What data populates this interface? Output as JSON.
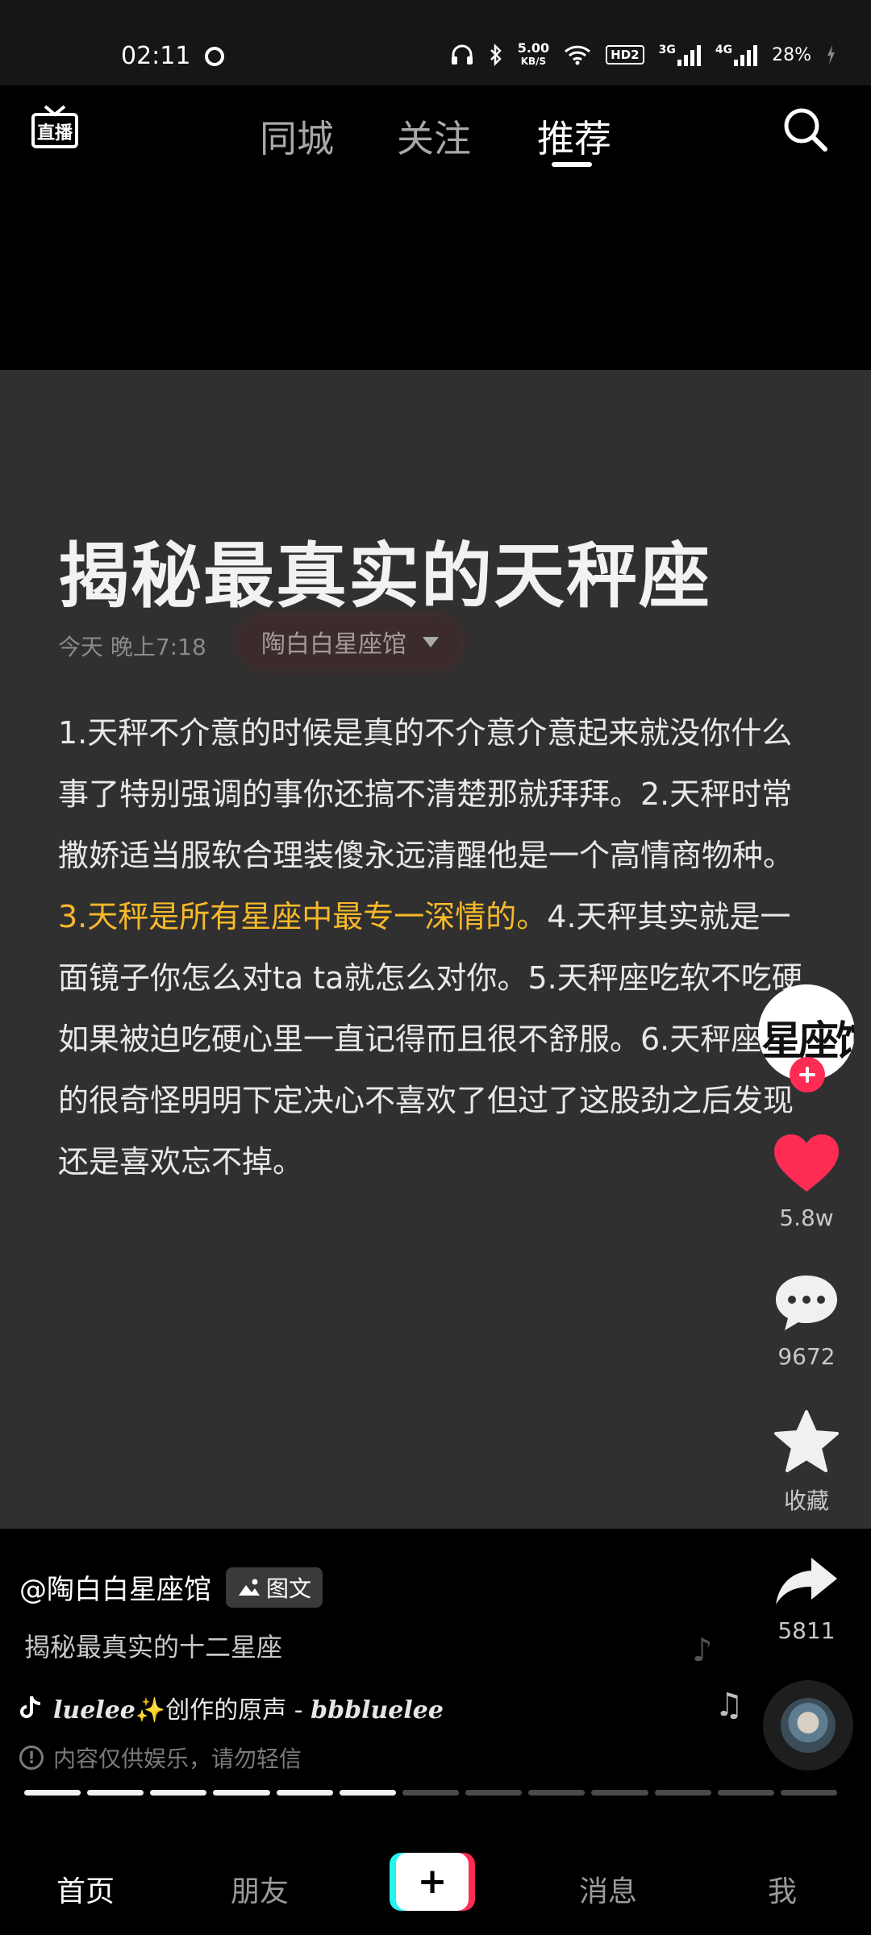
{
  "status_bar": {
    "time": "02:11",
    "net_speed_value": "5.00",
    "net_speed_unit": "KB/S",
    "hd_badge": "HD2",
    "sim1_label": "3G",
    "sim2_label": "4G",
    "battery": "28%"
  },
  "top_nav": {
    "live_label": "直播",
    "tabs": [
      "同城",
      "关注",
      "推荐"
    ],
    "active_tab": "推荐"
  },
  "post": {
    "title": "揭秘最真实的天秤座",
    "date": "今天 晚上7:18",
    "author_chip": "陶白白星座馆",
    "body_part1": "1.天秤不介意的时候是真的不介意介意起来就没你什么事了特别强调的事你还搞不清楚那就拜拜。2.天秤时常撒娇适当服软合理装傻永远清醒他是一个高情商物种。",
    "body_highlight": "3.天秤是所有星座中最专一深情的。",
    "body_part2": "4.天秤其实就是一面镜子你怎么对ta ta就怎么对你。5.天秤座吃软不吃硬如果被迫吃硬心里一直记得而且很不舒服。6.天秤座真的很奇怪明明下定决心不喜欢了但过了这股劲之后发现还是喜欢忘不掉。"
  },
  "rail": {
    "avatar_text": "星座馆",
    "likes": "5.8w",
    "comments": "9672",
    "favorite_label": "收藏",
    "shares": "5811"
  },
  "info": {
    "handle": "@陶白白星座馆",
    "badge": "图文",
    "description": "揭秘最真实的十二星座",
    "music_user": "luelee",
    "music_spark": "✨",
    "music_suffix": "创作的原声 - ",
    "music_tail": "bbbluelee",
    "disclaimer": "内容仅供娱乐，请勿轻信"
  },
  "progress": {
    "total": 13,
    "completed": 6
  },
  "tab_bar": {
    "home": "首页",
    "friends": "朋友",
    "create": "+",
    "messages": "消息",
    "me": "我"
  },
  "colors": {
    "highlight": "#f7b92a",
    "like_red": "#fe2c55",
    "card_bg": "#303030"
  }
}
